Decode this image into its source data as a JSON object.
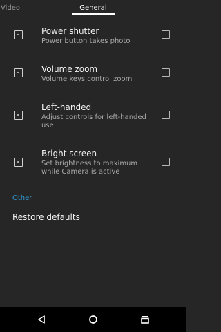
{
  "tabs": [
    {
      "label": "Video"
    },
    {
      "label": "General"
    }
  ],
  "settings": [
    {
      "title": "Power shutter",
      "summary": "Power button takes photo",
      "checked": false
    },
    {
      "title": "Volume zoom",
      "summary": "Volume keys control zoom",
      "checked": false
    },
    {
      "title": "Left-handed",
      "summary": "Adjust controls for left-handed use",
      "checked": false
    },
    {
      "title": "Bright screen",
      "summary": "Set brightness to maximum while Camera is active",
      "checked": false
    }
  ],
  "other": {
    "header": "Other",
    "restore_label": "Restore defaults"
  },
  "navbar": {
    "back_icon": "back-icon",
    "home_icon": "home-icon",
    "recents_icon": "recents-icon"
  },
  "colors": {
    "background": "#262626",
    "accent": "#2e9bd6",
    "navbar": "#000000"
  }
}
